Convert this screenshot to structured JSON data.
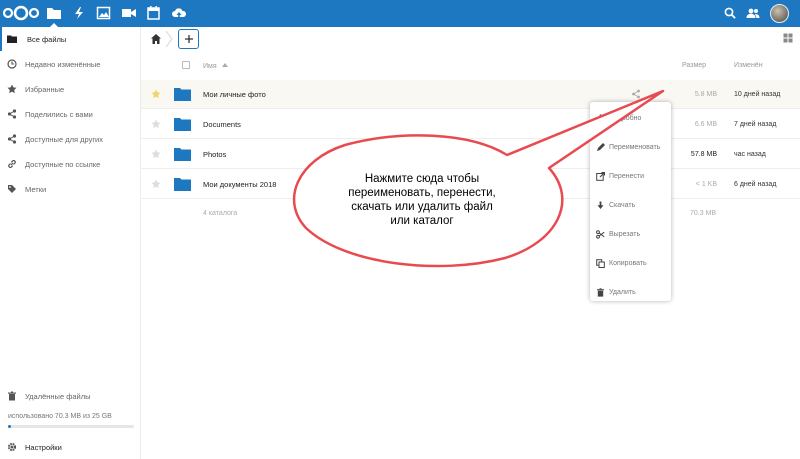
{
  "colors": {
    "header": "#1e78c1",
    "accent": "#1e78c1",
    "folder": "#1e78c1",
    "star": "#f0d56a",
    "callout": "#e94a4f"
  },
  "header": {
    "apps": [
      "files-icon",
      "activity-icon",
      "gallery-icon",
      "video-icon",
      "calendar-icon",
      "upload-icon"
    ],
    "right": [
      "search-icon",
      "contacts-icon",
      "avatar"
    ]
  },
  "sidebar": {
    "items": [
      {
        "label": "Все файлы",
        "icon": "folder-icon"
      },
      {
        "label": "Недавно изменённые",
        "icon": "clock-icon"
      },
      {
        "label": "Избранные",
        "icon": "star-icon"
      },
      {
        "label": "Поделились с вами",
        "icon": "share-icon"
      },
      {
        "label": "Доступные для других",
        "icon": "share-icon"
      },
      {
        "label": "Доступные по ссылке",
        "icon": "link-icon"
      },
      {
        "label": "Метки",
        "icon": "tag-icon"
      }
    ],
    "trash": "Удалённые файлы",
    "quota": "использовано 70.3 MB из 25 GB",
    "quota_fraction": 0.0028,
    "settings": "Настройки"
  },
  "table": {
    "headers": {
      "name": "Имя",
      "size": "Размер",
      "modified": "Изменён"
    },
    "rows": [
      {
        "name": "Мои личные фото",
        "size": "5.8 MB",
        "date": "10 дней назад",
        "size_color": "#aaaaaa"
      },
      {
        "name": "Documents",
        "size": "6.6 MB",
        "date": "7 дней назад",
        "size_color": "#aaaaaa"
      },
      {
        "name": "Photos",
        "size": "57.8 MB",
        "date": "час назад",
        "size_color": "#222222"
      },
      {
        "name": "Мои документы 2018",
        "size": "< 1 KB",
        "date": "6 дней назад",
        "size_color": "#aaaaaa"
      }
    ],
    "summary": "4 каталога",
    "summary_size": "70.3 MB"
  },
  "menu": {
    "items": [
      {
        "label": "Подробно",
        "icon": "info-icon"
      },
      {
        "label": "Переименовать",
        "icon": "rename-icon"
      },
      {
        "label": "Перенести",
        "icon": "move-icon"
      },
      {
        "label": "Скачать",
        "icon": "download-icon"
      },
      {
        "label": "Вырезать",
        "icon": "cut-icon"
      },
      {
        "label": "Копировать",
        "icon": "copy-icon"
      },
      {
        "label": "Удалить",
        "icon": "delete-icon"
      }
    ]
  },
  "callout": {
    "lines": [
      "Нажмите сюда чтобы",
      "переименовать, перенести,",
      "скачать или удалить файл",
      "или каталог"
    ]
  }
}
